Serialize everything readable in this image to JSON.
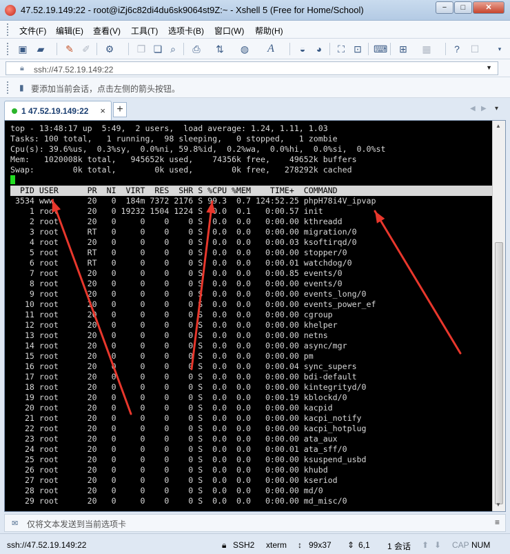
{
  "window": {
    "title": "47.52.19.149:22 - root@iZj6c82di4du6sk9064st9Z:~ - Xshell 5 (Free for Home/School)",
    "minimize": "−",
    "maximize": "□",
    "close": "✕"
  },
  "menu": [
    "文件(F)",
    "编辑(E)",
    "查看(V)",
    "工具(T)",
    "选项卡(B)",
    "窗口(W)",
    "帮助(H)"
  ],
  "toolbar_icons": [
    "new-session-icon",
    "open-folder-icon",
    "reconnect-icon",
    "disconnect-icon",
    "properties-icon",
    "copy-icon",
    "paste-icon",
    "find-icon",
    "print-icon",
    "transfer-icon",
    "globe-icon",
    "encoding-icon",
    "font-icon",
    "xftp-icon",
    "xmanager-icon",
    "fullscreen-icon",
    "lock-icon",
    "keyboard-icon",
    "new-tab-icon",
    "layout-icon",
    "help-icon",
    "chat-icon"
  ],
  "address": {
    "value": "ssh://47.52.19.149:22"
  },
  "hint": "要添加当前会话，点击左侧的箭头按钮。",
  "tab": {
    "label": "1 47.52.19.149:22",
    "close": "×",
    "add": "+"
  },
  "terminal": {
    "lines": [
      "top - 13:48:17 up  5:49,  2 users,  load average: 1.24, 1.11, 1.03",
      "Tasks: 100 total,   1 running,  98 sleeping,   0 stopped,   1 zombie",
      "Cpu(s): 39.6%us,  0.3%sy,  0.0%ni, 59.8%id,  0.2%wa,  0.0%hi,  0.0%si,  0.0%st",
      "Mem:   1020008k total,   945652k used,    74356k free,    49652k buffers",
      "Swap:        0k total,        0k used,        0k free,   278292k cached"
    ],
    "header": "  PID USER      PR  NI  VIRT  RES  SHR S %CPU %MEM    TIME+  COMMAND",
    "processes": [
      " 3534 www       20   0  184m 7372 2176 S 99.3  0.7 124:52.25 phpH78i4V_ipvap",
      "    1 root      20   0 19232 1504 1224 S  0.0  0.1   0:00.57 init",
      "    2 root      20   0     0    0    0 S  0.0  0.0   0:00.00 kthreadd",
      "    3 root      RT   0     0    0    0 S  0.0  0.0   0:00.00 migration/0",
      "    4 root      20   0     0    0    0 S  0.0  0.0   0:00.03 ksoftirqd/0",
      "    5 root      RT   0     0    0    0 S  0.0  0.0   0:00.00 stopper/0",
      "    6 root      RT   0     0    0    0 S  0.0  0.0   0:00.01 watchdog/0",
      "    7 root      20   0     0    0    0 S  0.0  0.0   0:00.85 events/0",
      "    8 root      20   0     0    0    0 S  0.0  0.0   0:00.00 events/0",
      "    9 root      20   0     0    0    0 S  0.0  0.0   0:00.00 events_long/0",
      "   10 root      20   0     0    0    0 S  0.0  0.0   0:00.00 events_power_ef",
      "   11 root      20   0     0    0    0 S  0.0  0.0   0:00.00 cgroup",
      "   12 root      20   0     0    0    0 S  0.0  0.0   0:00.00 khelper",
      "   13 root      20   0     0    0    0 S  0.0  0.0   0:00.00 netns",
      "   14 root      20   0     0    0    0 S  0.0  0.0   0:00.00 async/mgr",
      "   15 root      20   0     0    0    0 S  0.0  0.0   0:00.00 pm",
      "   16 root      20   0     0    0    0 S  0.0  0.0   0:00.04 sync_supers",
      "   17 root      20   0     0    0    0 S  0.0  0.0   0:00.00 bdi-default",
      "   18 root      20   0     0    0    0 S  0.0  0.0   0:00.00 kintegrityd/0",
      "   19 root      20   0     0    0    0 S  0.0  0.0   0:00.19 kblockd/0",
      "   20 root      20   0     0    0    0 S  0.0  0.0   0:00.00 kacpid",
      "   21 root      20   0     0    0    0 S  0.0  0.0   0:00.00 kacpi_notify",
      "   22 root      20   0     0    0    0 S  0.0  0.0   0:00.00 kacpi_hotplug",
      "   23 root      20   0     0    0    0 S  0.0  0.0   0:00.00 ata_aux",
      "   24 root      20   0     0    0    0 S  0.0  0.0   0:00.01 ata_sff/0",
      "   25 root      20   0     0    0    0 S  0.0  0.0   0:00.00 ksuspend_usbd",
      "   26 root      20   0     0    0    0 S  0.0  0.0   0:00.00 khubd",
      "   27 root      20   0     0    0    0 S  0.0  0.0   0:00.00 kseriod",
      "   28 root      20   0     0    0    0 S  0.0  0.0   0:00.00 md/0",
      "   29 root      20   0     0    0    0 S  0.0  0.0   0:00.00 md_misc/0"
    ]
  },
  "sendbar": {
    "text": "仅将文本发送到当前选项卡"
  },
  "status": {
    "address": "ssh://47.52.19.149:22",
    "protocol": "SSH2",
    "term": "xterm",
    "size": "99x37",
    "cursor": "6,1",
    "sessions": "1 会话",
    "cap": "CAP",
    "num": "NUM"
  },
  "annotation_color": "#e8372c"
}
